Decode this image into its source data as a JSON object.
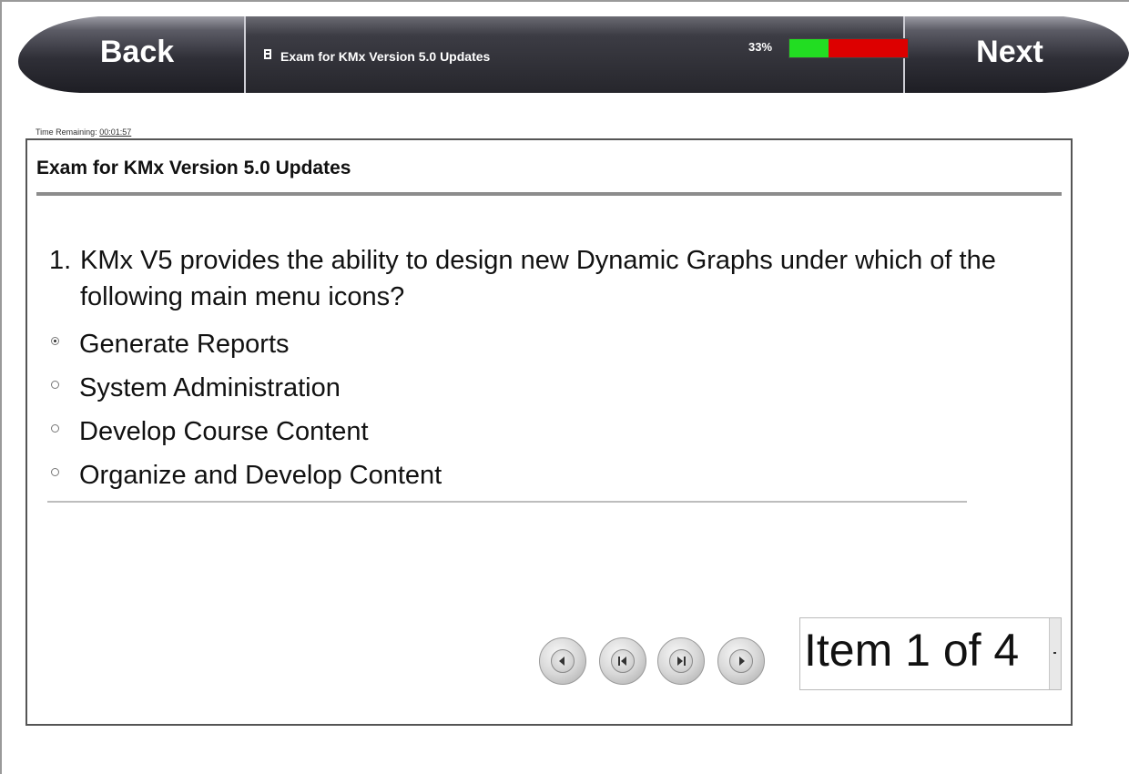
{
  "nav": {
    "back_label": "Back",
    "next_label": "Next"
  },
  "header": {
    "title": "Exam for KMx Version 5.0 Updates",
    "progress_label": "33%",
    "progress_fraction": 0.33
  },
  "timer": {
    "label": "Time Remaining:",
    "value": "00:01:57"
  },
  "content": {
    "title": "Exam for KMx Version 5.0 Updates",
    "question_number": "1.",
    "question_text": "KMx V5 provides the ability to design new Dynamic Graphs under which of the following main menu icons?",
    "options": [
      {
        "label": "Generate Reports",
        "selected": true
      },
      {
        "label": "System Administration",
        "selected": false
      },
      {
        "label": "Develop Course Content",
        "selected": false
      },
      {
        "label": "Organize and Develop Content",
        "selected": false
      }
    ]
  },
  "pager": {
    "item_display": "Item 1 of  4"
  },
  "colors": {
    "progress_done": "#22dd22",
    "progress_remaining": "#dd0000",
    "bar_dark": "#2b2b33"
  }
}
